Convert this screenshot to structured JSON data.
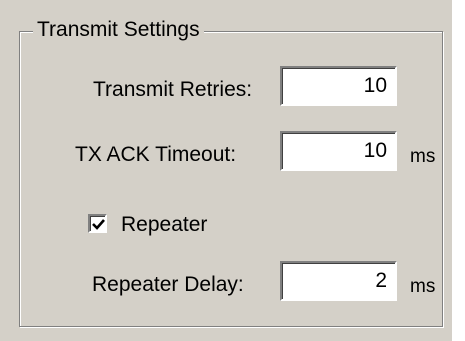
{
  "group": {
    "title": "Transmit Settings"
  },
  "transmit_retries": {
    "label": "Transmit Retries:",
    "value": "10"
  },
  "tx_ack_timeout": {
    "label": "TX ACK Timeout:",
    "value": "10",
    "unit": "ms"
  },
  "repeater": {
    "label": "Repeater",
    "checked": true,
    "check_icon": "checkmark-icon"
  },
  "repeater_delay": {
    "label": "Repeater Delay:",
    "value": "2",
    "unit": "ms"
  }
}
